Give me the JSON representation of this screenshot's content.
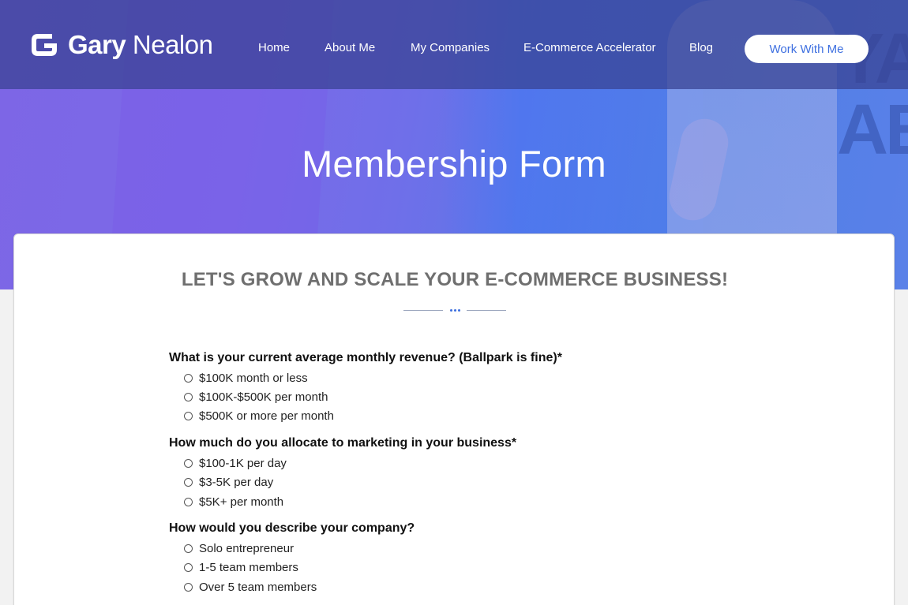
{
  "brand": {
    "name_first": "Gary",
    "name_last": "Nealon"
  },
  "nav": {
    "items": [
      {
        "label": "Home"
      },
      {
        "label": "About Me"
      },
      {
        "label": "My Companies"
      },
      {
        "label": "E-Commerce Accelerator"
      },
      {
        "label": "Blog"
      }
    ],
    "cta_label": "Work With Me"
  },
  "hero": {
    "title": "Membership Form",
    "bg_text": "YA\nAE"
  },
  "card": {
    "heading": "LET'S GROW AND SCALE YOUR E-COMMERCE BUSINESS!"
  },
  "form": {
    "questions": [
      {
        "label": "What is your current average monthly revenue? (Ballpark is fine)*",
        "options": [
          "$100K month or less",
          "$100K-$500K per month",
          "$500K or more per month"
        ]
      },
      {
        "label": "How much do you allocate to marketing in your business*",
        "options": [
          "$100-1K per day",
          "$3-5K per day",
          "$5K+ per month"
        ]
      },
      {
        "label": "How would you describe your company?",
        "options": [
          "Solo entrepreneur",
          "1-5 team members",
          "Over 5 team members"
        ]
      }
    ]
  },
  "colors": {
    "accent": "#3d6fe0",
    "hero_purple": "#7d66e6",
    "hero_blue": "#4f7de6",
    "heading_gray": "#6f6f6f"
  }
}
